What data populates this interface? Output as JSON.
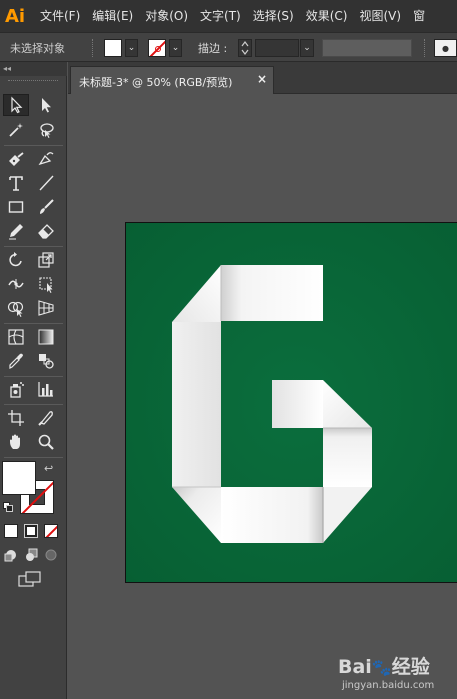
{
  "app": {
    "logo": "Ai",
    "menu": [
      "文件(F)",
      "编辑(E)",
      "对象(O)",
      "文字(T)",
      "选择(S)",
      "效果(C)",
      "视图(V)",
      "窗"
    ]
  },
  "control_bar": {
    "selection_label": "未选择对象",
    "stroke_label": "描边",
    "stroke_colon": ":",
    "dropdown_glyph": "⌄",
    "fill_color": "#ffffff",
    "stroke_color": "none"
  },
  "toolbar": {
    "collapse_glyph": "◂◂",
    "swap_glyph": "↩",
    "tools": [
      "selection-tool",
      "direct-selection-tool",
      "magic-wand-tool",
      "lasso-tool",
      "pen-tool",
      "curvature-tool",
      "type-tool",
      "line-segment-tool",
      "rectangle-tool",
      "paintbrush-tool",
      "pencil-tool",
      "eraser-tool",
      "rotate-tool",
      "scale-tool",
      "width-tool",
      "free-transform-tool",
      "shape-builder-tool",
      "perspective-grid-tool",
      "mesh-tool",
      "gradient-tool",
      "eyedropper-tool",
      "blend-tool",
      "symbol-sprayer-tool",
      "column-graph-tool",
      "artboard-tool",
      "slice-tool",
      "hand-tool",
      "zoom-tool"
    ]
  },
  "document": {
    "tab_title": "未标题-3* @ 50% (RGB/预览)",
    "close_glyph": "×",
    "artboard_color": "#0a6a3b"
  },
  "watermark": {
    "brand_left": "Bai",
    "brand_paw": "🐾",
    "brand_right": "经验",
    "url": "jingyan.baidu.com"
  }
}
